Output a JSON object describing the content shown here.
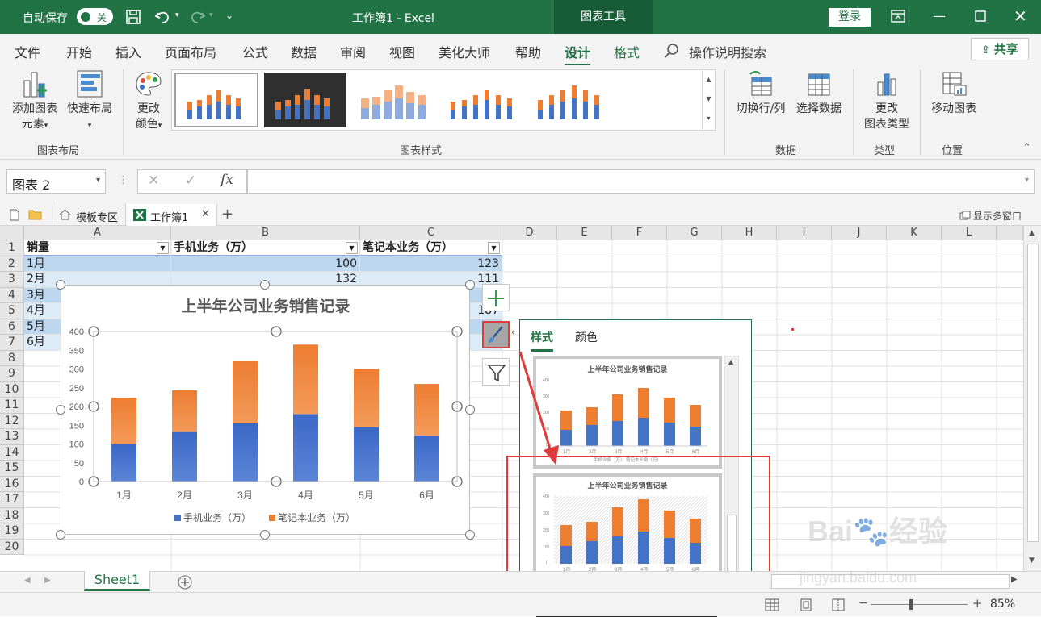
{
  "titlebar": {
    "autosave": "自动保存",
    "autosave_state": "关",
    "title": "工作簿1 - Excel",
    "chart_tools": "图表工具",
    "login": "登录"
  },
  "tabs": [
    "文件",
    "开始",
    "插入",
    "页面布局",
    "公式",
    "数据",
    "审阅",
    "视图",
    "美化大师",
    "帮助",
    "设计",
    "格式"
  ],
  "active_tab": "设计",
  "search_label": "操作说明搜索",
  "share_label": "共享",
  "ribbon": {
    "add_element": "添加图表",
    "add_element_2": "元素",
    "quick_layout": "快速布局",
    "change_color": "更改",
    "change_color_2": "颜色",
    "group_layout": "图表布局",
    "group_styles": "图表样式",
    "switch_rowcol": "切换行/列",
    "select_data": "选择数据",
    "group_data": "数据",
    "change_type": "更改",
    "change_type_2": "图表类型",
    "group_type": "类型",
    "move_chart": "移动图表",
    "group_location": "位置"
  },
  "namebox": "图表 2",
  "doctabs": {
    "template": "模板专区",
    "workbook": "工作簿1",
    "multiwin": "显示多窗口"
  },
  "columns": [
    "A",
    "B",
    "C",
    "D",
    "E",
    "F",
    "G",
    "H",
    "I",
    "J",
    "K",
    "L"
  ],
  "rows": [
    "1",
    "2",
    "3",
    "4",
    "5",
    "6",
    "7",
    "8",
    "9",
    "10",
    "11",
    "12",
    "13",
    "14",
    "15",
    "16",
    "17",
    "18",
    "19",
    "20"
  ],
  "table": {
    "headers": [
      "销量",
      "手机业务（万）",
      "笔记本业务（万）"
    ],
    "months": [
      "1月",
      "2月",
      "3月",
      "4月",
      "5月",
      "6月"
    ],
    "col_b": [
      "100",
      "132",
      "",
      "",
      "",
      ""
    ],
    "col_c": [
      "123",
      "111",
      "",
      "187",
      "",
      ""
    ]
  },
  "style_panel": {
    "tab_style": "样式",
    "tab_color": "颜色"
  },
  "sheet_tab": "Sheet1",
  "zoom": "85%",
  "colors": {
    "excel_green": "#217346",
    "blue": "#4472c4",
    "orange": "#ed7d31",
    "red": "#e03a3a"
  },
  "chart_data": {
    "type": "bar",
    "stacked": true,
    "title": "上半年公司业务销售记录",
    "categories": [
      "1月",
      "2月",
      "3月",
      "4月",
      "5月",
      "6月"
    ],
    "series": [
      {
        "name": "手机业务（万）",
        "values": [
          100,
          132,
          155,
          180,
          145,
          123
        ]
      },
      {
        "name": "笔记本业务（万）",
        "values": [
          123,
          111,
          166,
          185,
          155,
          137
        ]
      }
    ],
    "ylim": [
      0,
      400
    ],
    "yticks": [
      "400",
      "350",
      "300",
      "250",
      "200",
      "150",
      "100",
      "50",
      "0"
    ],
    "legend": "bottom",
    "grid": false
  }
}
